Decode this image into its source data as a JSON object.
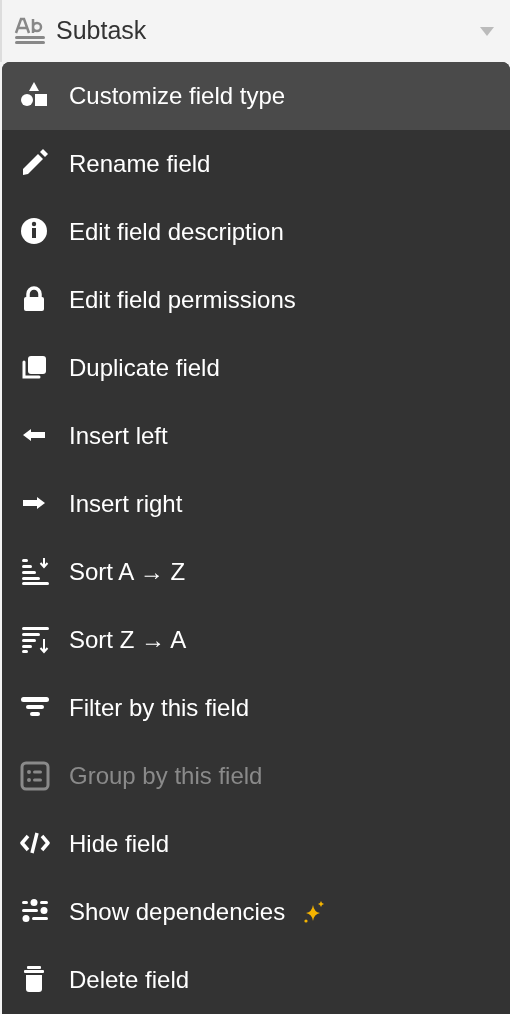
{
  "field_header": {
    "name": "Subtask"
  },
  "menu": {
    "items": [
      {
        "label": "Customize field type",
        "selected": true,
        "disabled": false
      },
      {
        "label": "Rename field",
        "selected": false,
        "disabled": false
      },
      {
        "label": "Edit field description",
        "selected": false,
        "disabled": false
      },
      {
        "label": "Edit field permissions",
        "selected": false,
        "disabled": false
      },
      {
        "label": "Duplicate field",
        "selected": false,
        "disabled": false
      },
      {
        "label": "Insert left",
        "selected": false,
        "disabled": false
      },
      {
        "label": "Insert right",
        "selected": false,
        "disabled": false
      },
      {
        "label": "Sort A → Z",
        "selected": false,
        "disabled": false
      },
      {
        "label": "Sort Z → A",
        "selected": false,
        "disabled": false
      },
      {
        "label": "Filter by this field",
        "selected": false,
        "disabled": false
      },
      {
        "label": "Group by this field",
        "selected": false,
        "disabled": true
      },
      {
        "label": "Hide field",
        "selected": false,
        "disabled": false
      },
      {
        "label": "Show dependencies",
        "selected": false,
        "disabled": false
      },
      {
        "label": "Delete field",
        "selected": false,
        "disabled": false
      }
    ]
  }
}
